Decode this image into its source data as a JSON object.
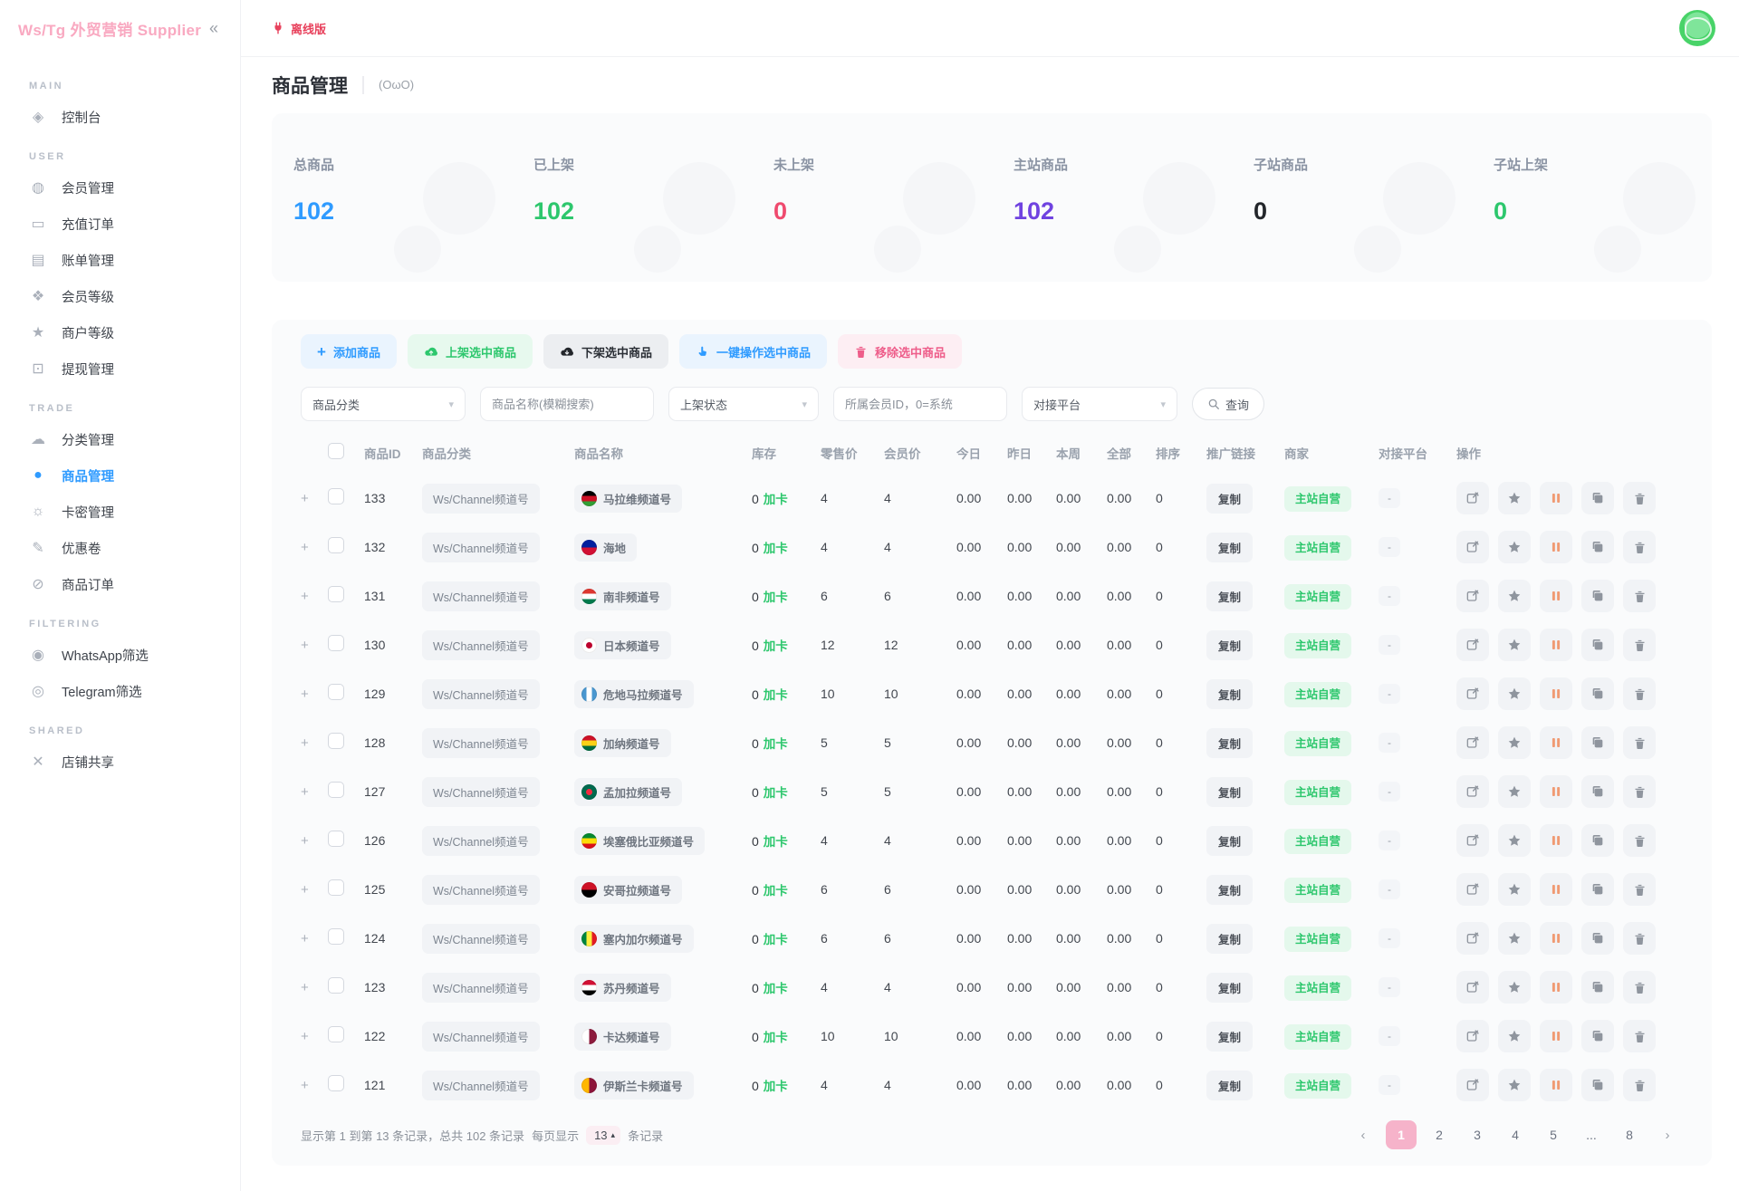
{
  "brand": {
    "title": "Ws/Tg 外贸营销 Supplier",
    "collapse_icon": "«"
  },
  "topbar": {
    "offline_badge": "离线版"
  },
  "page": {
    "title": "商品管理",
    "emote": "(OωO)"
  },
  "sidebar": {
    "sections": [
      {
        "title": "MAIN",
        "items": [
          {
            "label": "控制台",
            "icon": "dashboard-icon",
            "glyph": "◈"
          }
        ]
      },
      {
        "title": "USER",
        "items": [
          {
            "label": "会员管理",
            "icon": "member-management-icon",
            "glyph": "◍"
          },
          {
            "label": "充值订单",
            "icon": "recharge-order-icon",
            "glyph": "▭"
          },
          {
            "label": "账单管理",
            "icon": "billing-icon",
            "glyph": "▤"
          },
          {
            "label": "会员等级",
            "icon": "member-level-icon",
            "glyph": "❖"
          },
          {
            "label": "商户等级",
            "icon": "merchant-level-icon",
            "glyph": "★"
          },
          {
            "label": "提现管理",
            "icon": "withdrawal-icon",
            "glyph": "⊡"
          }
        ]
      },
      {
        "title": "TRADE",
        "items": [
          {
            "label": "分类管理",
            "icon": "category-management-icon",
            "glyph": "☁"
          },
          {
            "label": "商品管理",
            "icon": "product-management-icon",
            "glyph": "●",
            "active": true
          },
          {
            "label": "卡密管理",
            "icon": "card-key-icon",
            "glyph": "☼"
          },
          {
            "label": "优惠卷",
            "icon": "coupon-icon",
            "glyph": "✎"
          },
          {
            "label": "商品订单",
            "icon": "product-order-icon",
            "glyph": "⊘"
          }
        ]
      },
      {
        "title": "FILTERING",
        "items": [
          {
            "label": "WhatsApp筛选",
            "icon": "whatsapp-filter-icon",
            "glyph": "◉"
          },
          {
            "label": "Telegram筛选",
            "icon": "telegram-filter-icon",
            "glyph": "◎"
          }
        ]
      },
      {
        "title": "SHARED",
        "items": [
          {
            "label": "店铺共享",
            "icon": "shop-share-icon",
            "glyph": "✕"
          }
        ]
      }
    ]
  },
  "stats": [
    {
      "label": "总商品",
      "value": "102",
      "color": "#2f9bff"
    },
    {
      "label": "已上架",
      "value": "102",
      "color": "#2dc76d"
    },
    {
      "label": "未上架",
      "value": "0",
      "color": "#ef4a6e"
    },
    {
      "label": "主站商品",
      "value": "102",
      "color": "#6f42e0"
    },
    {
      "label": "子站商品",
      "value": "0",
      "color": "#23262b"
    },
    {
      "label": "子站上架",
      "value": "0",
      "color": "#2dc76d"
    }
  ],
  "toolbar": {
    "add_label": "添加商品",
    "onshelf_label": "上架选中商品",
    "offshelf_label": "下架选中商品",
    "oneclick_label": "一键操作选中商品",
    "remove_label": "移除选中商品"
  },
  "filters": {
    "category": "商品分类",
    "name_placeholder": "商品名称(模糊搜索)",
    "status": "上架状态",
    "member_placeholder": "所属会员ID，0=系统",
    "platform": "对接平台",
    "search_label": "查询"
  },
  "table": {
    "columns": [
      "商品ID",
      "商品分类",
      "商品名称",
      "库存",
      "零售价",
      "会员价",
      "今日",
      "昨日",
      "本周",
      "全部",
      "排序",
      "推广链接",
      "商家",
      "对接平台",
      "操作"
    ],
    "rows": [
      {
        "id": "133",
        "category": "Ws/Channel频道号",
        "name": "马拉维频道号",
        "flag": {
          "type": "stripes",
          "dir": "h",
          "colors": [
            "#000000",
            "#ce1126",
            "#339e35"
          ]
        },
        "stock": "0",
        "stock_action": "加卡",
        "retail": "4",
        "member_price": "4",
        "today": "0.00",
        "yesterday": "0.00",
        "week": "0.00",
        "total": "0.00",
        "sort": "0",
        "promo": "复制",
        "merchant": "主站自营",
        "platform": "-"
      },
      {
        "id": "132",
        "category": "Ws/Channel频道号",
        "name": "海地",
        "flag": {
          "type": "stripes",
          "dir": "h",
          "colors": [
            "#00209f",
            "#d21034"
          ]
        },
        "stock": "0",
        "stock_action": "加卡",
        "retail": "4",
        "member_price": "4",
        "today": "0.00",
        "yesterday": "0.00",
        "week": "0.00",
        "total": "0.00",
        "sort": "0",
        "promo": "复制",
        "merchant": "主站自营",
        "platform": "-"
      },
      {
        "id": "131",
        "category": "Ws/Channel频道号",
        "name": "南非频道号",
        "flag": {
          "type": "stripes",
          "dir": "h",
          "colors": [
            "#de3831",
            "#ffffff",
            "#007a4d"
          ]
        },
        "stock": "0",
        "stock_action": "加卡",
        "retail": "6",
        "member_price": "6",
        "today": "0.00",
        "yesterday": "0.00",
        "week": "0.00",
        "total": "0.00",
        "sort": "0",
        "promo": "复制",
        "merchant": "主站自营",
        "platform": "-"
      },
      {
        "id": "130",
        "category": "Ws/Channel频道号",
        "name": "日本频道号",
        "flag": {
          "type": "disc",
          "bg": "#ffffff",
          "disc": "#bc002d"
        },
        "stock": "0",
        "stock_action": "加卡",
        "retail": "12",
        "member_price": "12",
        "today": "0.00",
        "yesterday": "0.00",
        "week": "0.00",
        "total": "0.00",
        "sort": "0",
        "promo": "复制",
        "merchant": "主站自营",
        "platform": "-"
      },
      {
        "id": "129",
        "category": "Ws/Channel频道号",
        "name": "危地马拉频道号",
        "flag": {
          "type": "stripes",
          "dir": "v",
          "colors": [
            "#4997d0",
            "#ffffff",
            "#4997d0"
          ]
        },
        "stock": "0",
        "stock_action": "加卡",
        "retail": "10",
        "member_price": "10",
        "today": "0.00",
        "yesterday": "0.00",
        "week": "0.00",
        "total": "0.00",
        "sort": "0",
        "promo": "复制",
        "merchant": "主站自营",
        "platform": "-"
      },
      {
        "id": "128",
        "category": "Ws/Channel频道号",
        "name": "加纳频道号",
        "flag": {
          "type": "stripes",
          "dir": "h",
          "colors": [
            "#ce1126",
            "#fcd116",
            "#006b3f"
          ]
        },
        "stock": "0",
        "stock_action": "加卡",
        "retail": "5",
        "member_price": "5",
        "today": "0.00",
        "yesterday": "0.00",
        "week": "0.00",
        "total": "0.00",
        "sort": "0",
        "promo": "复制",
        "merchant": "主站自营",
        "platform": "-"
      },
      {
        "id": "127",
        "category": "Ws/Channel频道号",
        "name": "孟加拉频道号",
        "flag": {
          "type": "disc",
          "bg": "#006a4e",
          "disc": "#f42a41"
        },
        "stock": "0",
        "stock_action": "加卡",
        "retail": "5",
        "member_price": "5",
        "today": "0.00",
        "yesterday": "0.00",
        "week": "0.00",
        "total": "0.00",
        "sort": "0",
        "promo": "复制",
        "merchant": "主站自营",
        "platform": "-"
      },
      {
        "id": "126",
        "category": "Ws/Channel频道号",
        "name": "埃塞俄比亚频道号",
        "flag": {
          "type": "stripes",
          "dir": "h",
          "colors": [
            "#078930",
            "#fcdd09",
            "#da121a"
          ]
        },
        "stock": "0",
        "stock_action": "加卡",
        "retail": "4",
        "member_price": "4",
        "today": "0.00",
        "yesterday": "0.00",
        "week": "0.00",
        "total": "0.00",
        "sort": "0",
        "promo": "复制",
        "merchant": "主站自营",
        "platform": "-"
      },
      {
        "id": "125",
        "category": "Ws/Channel频道号",
        "name": "安哥拉频道号",
        "flag": {
          "type": "stripes",
          "dir": "h",
          "colors": [
            "#ce1126",
            "#000000"
          ]
        },
        "stock": "0",
        "stock_action": "加卡",
        "retail": "6",
        "member_price": "6",
        "today": "0.00",
        "yesterday": "0.00",
        "week": "0.00",
        "total": "0.00",
        "sort": "0",
        "promo": "复制",
        "merchant": "主站自营",
        "platform": "-"
      },
      {
        "id": "124",
        "category": "Ws/Channel频道号",
        "name": "塞内加尔频道号",
        "flag": {
          "type": "stripes",
          "dir": "v",
          "colors": [
            "#00853f",
            "#fdef42",
            "#e31b23"
          ]
        },
        "stock": "0",
        "stock_action": "加卡",
        "retail": "6",
        "member_price": "6",
        "today": "0.00",
        "yesterday": "0.00",
        "week": "0.00",
        "total": "0.00",
        "sort": "0",
        "promo": "复制",
        "merchant": "主站自营",
        "platform": "-"
      },
      {
        "id": "123",
        "category": "Ws/Channel频道号",
        "name": "苏丹频道号",
        "flag": {
          "type": "stripes",
          "dir": "h",
          "colors": [
            "#d21034",
            "#ffffff",
            "#000000"
          ]
        },
        "stock": "0",
        "stock_action": "加卡",
        "retail": "4",
        "member_price": "4",
        "today": "0.00",
        "yesterday": "0.00",
        "week": "0.00",
        "total": "0.00",
        "sort": "0",
        "promo": "复制",
        "merchant": "主站自营",
        "platform": "-"
      },
      {
        "id": "122",
        "category": "Ws/Channel频道号",
        "name": "卡达频道号",
        "flag": {
          "type": "stripes",
          "dir": "v",
          "colors": [
            "#ffffff",
            "#8d1b3d"
          ]
        },
        "stock": "0",
        "stock_action": "加卡",
        "retail": "10",
        "member_price": "10",
        "today": "0.00",
        "yesterday": "0.00",
        "week": "0.00",
        "total": "0.00",
        "sort": "0",
        "promo": "复制",
        "merchant": "主站自营",
        "platform": "-"
      },
      {
        "id": "121",
        "category": "Ws/Channel频道号",
        "name": "伊斯兰卡频道号",
        "flag": {
          "type": "stripes",
          "dir": "v",
          "colors": [
            "#ffb700",
            "#8d153a"
          ]
        },
        "stock": "0",
        "stock_action": "加卡",
        "retail": "4",
        "member_price": "4",
        "today": "0.00",
        "yesterday": "0.00",
        "week": "0.00",
        "total": "0.00",
        "sort": "0",
        "promo": "复制",
        "merchant": "主站自营",
        "platform": "-"
      }
    ]
  },
  "footer": {
    "summary": "显示第 1 到第 13 条记录，总共 102 条记录",
    "per_page_prefix": "每页显示",
    "per_page": "13",
    "per_page_suffix": "条记录"
  },
  "pagination": {
    "prev": "‹",
    "next": "›",
    "pages": [
      {
        "label": "1",
        "active": true
      },
      {
        "label": "2"
      },
      {
        "label": "3"
      },
      {
        "label": "4"
      },
      {
        "label": "5"
      },
      {
        "label": "..."
      },
      {
        "label": "8"
      }
    ]
  }
}
